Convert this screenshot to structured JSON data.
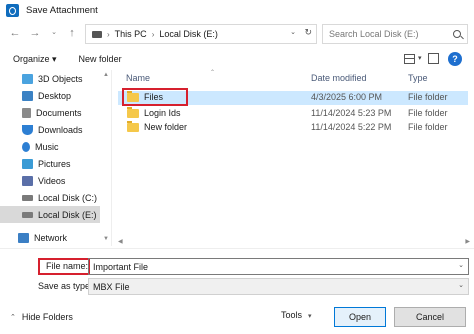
{
  "window": {
    "title": "Save Attachment"
  },
  "address": {
    "crumbs": [
      "This PC",
      "Local Disk (E:)"
    ],
    "search_placeholder": "Search Local Disk (E:)"
  },
  "toolbar": {
    "organize_label": "Organize ▾",
    "new_folder_label": "New folder"
  },
  "sidebar": {
    "items": [
      {
        "label": "3D Objects",
        "icon": "3d-objects-icon",
        "color": "#4aa3df"
      },
      {
        "label": "Desktop",
        "icon": "desktop-icon",
        "color": "#3b82c4"
      },
      {
        "label": "Documents",
        "icon": "documents-icon",
        "color": "#8a8a8a"
      },
      {
        "label": "Downloads",
        "icon": "downloads-icon",
        "color": "#2d7fd3"
      },
      {
        "label": "Music",
        "icon": "music-icon",
        "color": "#2d7fd3"
      },
      {
        "label": "Pictures",
        "icon": "pictures-icon",
        "color": "#3a9bd5"
      },
      {
        "label": "Videos",
        "icon": "videos-icon",
        "color": "#5a6fa8"
      },
      {
        "label": "Local Disk (C:)",
        "icon": "drive-icon",
        "color": "#7a7a7a"
      },
      {
        "label": "Local Disk (E:)",
        "icon": "drive-icon",
        "color": "#7a7a7a",
        "selected": true
      },
      {
        "label": "Network",
        "icon": "network-icon",
        "color": "#3b7fc4"
      }
    ]
  },
  "columns": {
    "name": "Name",
    "date": "Date modified",
    "type": "Type"
  },
  "files": [
    {
      "name": "Files",
      "date": "4/3/2025 6:00 PM",
      "type": "File folder",
      "selected": true
    },
    {
      "name": "Login Ids",
      "date": "11/14/2024 5:23 PM",
      "type": "File folder"
    },
    {
      "name": "New folder",
      "date": "11/14/2024 5:22 PM",
      "type": "File folder"
    }
  ],
  "form": {
    "file_name_label": "File name:",
    "file_name_value": "Important File",
    "save_type_label": "Save as type:",
    "save_type_value": "MBX File"
  },
  "footer": {
    "hide_folders": "Hide Folders",
    "tools": "Tools",
    "open": "Open",
    "cancel": "Cancel"
  },
  "colors": {
    "highlight": "#d6202e",
    "selection": "#cce8ff",
    "accent": "#0078d7"
  }
}
